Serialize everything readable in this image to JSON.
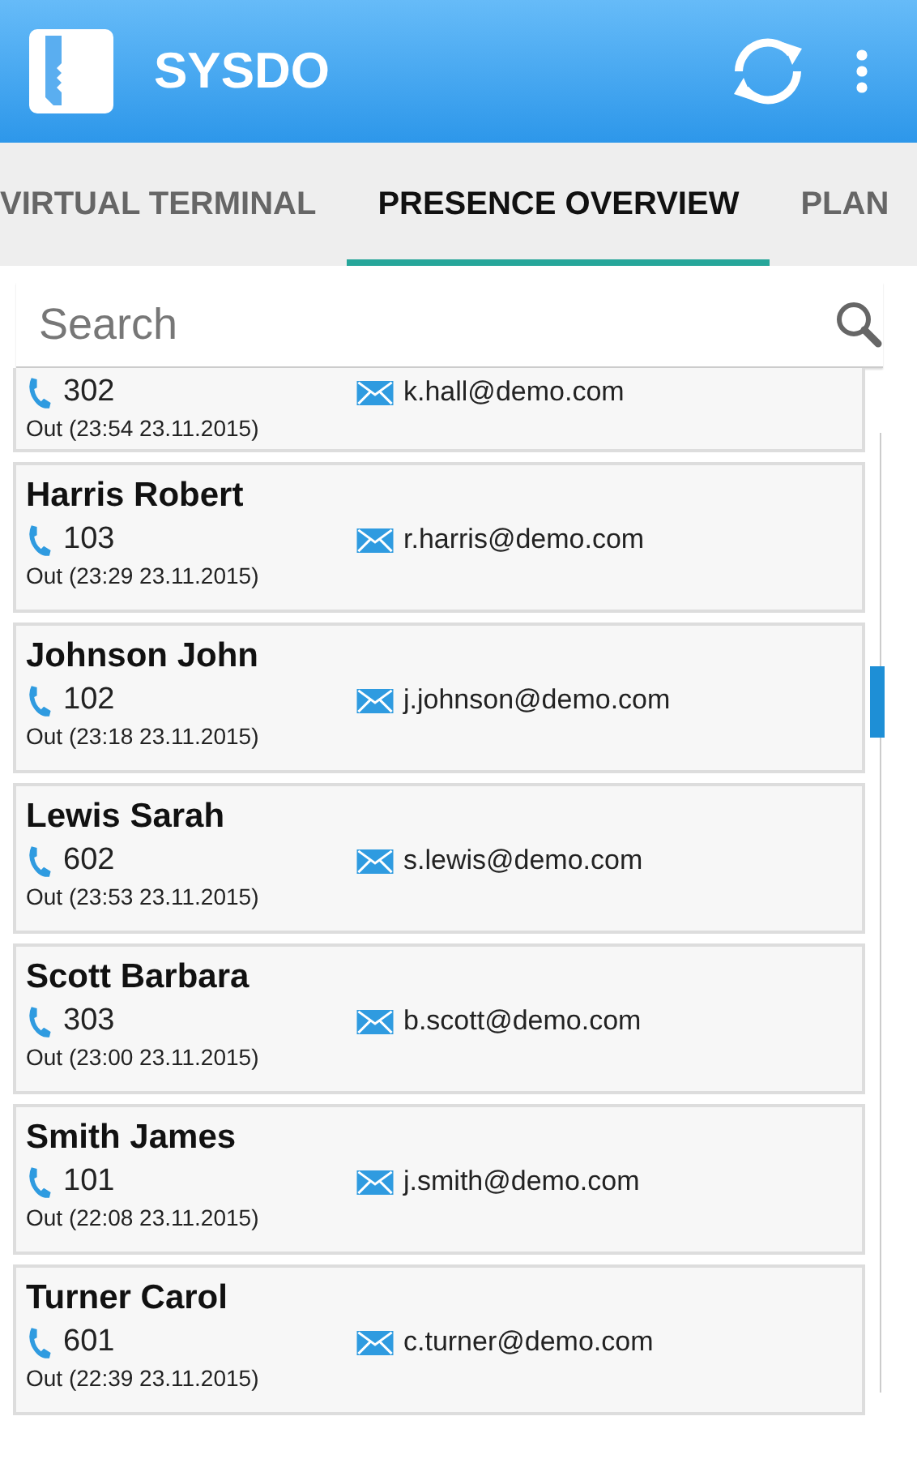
{
  "app_bar": {
    "title": "SYSDO"
  },
  "tabs": [
    {
      "label": "VIRTUAL TERMINAL",
      "selected": false
    },
    {
      "label": "PRESENCE OVERVIEW",
      "selected": true
    },
    {
      "label": "PLAN",
      "selected": false
    }
  ],
  "search": {
    "placeholder": "Search"
  },
  "contacts": [
    {
      "extension": "302",
      "email": "k.hall@demo.com",
      "status": "Out (23:54 23.11.2015)"
    },
    {
      "name": "Harris Robert",
      "extension": "103",
      "email": "r.harris@demo.com",
      "status": "Out (23:29 23.11.2015)"
    },
    {
      "name": "Johnson John",
      "extension": "102",
      "email": "j.johnson@demo.com",
      "status": "Out (23:18 23.11.2015)"
    },
    {
      "name": "Lewis Sarah",
      "extension": "602",
      "email": "s.lewis@demo.com",
      "status": "Out (23:53 23.11.2015)"
    },
    {
      "name": "Scott Barbara",
      "extension": "303",
      "email": "b.scott@demo.com",
      "status": "Out (23:00 23.11.2015)"
    },
    {
      "name": "Smith James",
      "extension": "101",
      "email": "j.smith@demo.com",
      "status": "Out (22:08 23.11.2015)"
    },
    {
      "name": "Turner Carol",
      "extension": "601",
      "email": "c.turner@demo.com",
      "status": "Out (22:39 23.11.2015)"
    }
  ]
}
